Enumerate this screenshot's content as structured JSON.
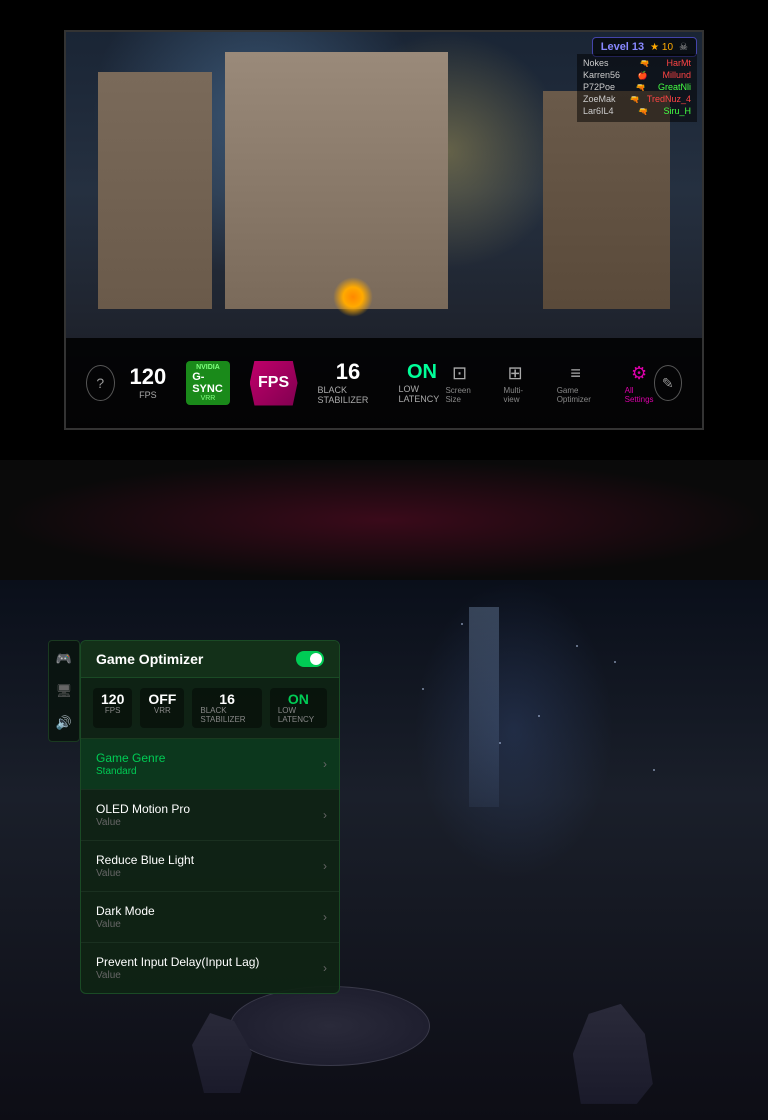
{
  "top_section": {
    "level": {
      "label": "Level 13",
      "stars": "★ 10",
      "skull": "☠"
    },
    "scoreboard": {
      "players": [
        {
          "name": "Nokes",
          "icon": "🔫",
          "team": "HarMt",
          "color": "red"
        },
        {
          "name": "Karren56",
          "icon": "🍎",
          "team": "Millund",
          "color": "red"
        },
        {
          "name": "P72Poe",
          "icon": "🔫",
          "team": "GreatNli",
          "color": "green"
        },
        {
          "name": "ZoeMak",
          "icon": "🔫",
          "team": "TredNuz_4",
          "color": "red"
        },
        {
          "name": "Lar6IL4",
          "icon": "🔫",
          "team": "Siru_H",
          "color": "green"
        }
      ]
    },
    "hud": {
      "fps_value": "120",
      "fps_label": "FPS",
      "gsync_label": "NVIDIA",
      "gsync_name": "G-SYNC",
      "gsync_vrr": "VRR",
      "center_badge": "FPS",
      "black_stab_value": "16",
      "black_stab_label": "Black Stabilizer",
      "latency_value": "ON",
      "latency_label": "Low Latency"
    },
    "bottom_icons": {
      "help_icon": "?",
      "screen_size_label": "Screen Size",
      "screen_size_icon": "⊡",
      "multiview_label": "Multi-view",
      "multiview_icon": "⊞",
      "optimizer_label": "Game Optimizer",
      "optimizer_icon": "≡",
      "settings_label": "All Settings",
      "settings_icon": "⚙",
      "edit_icon": "✎"
    }
  },
  "bottom_section": {
    "side_icons": {
      "gamepad_icon": "🎮",
      "display_icon": "🖥",
      "volume_icon": "🔊"
    },
    "optimizer_panel": {
      "title": "Game Optimizer",
      "toggle_on": true,
      "stats": [
        {
          "value": "120",
          "label": "FPS"
        },
        {
          "value": "OFF",
          "label": "VRR"
        },
        {
          "value": "16",
          "label": "Black Stabilizer"
        },
        {
          "value": "ON",
          "label": "Low Latency"
        }
      ],
      "menu_items": [
        {
          "title": "Game Genre",
          "value": "Standard",
          "highlighted": true,
          "title_color": "green",
          "value_color": "green"
        },
        {
          "title": "OLED Motion Pro",
          "value": "Value",
          "highlighted": false
        },
        {
          "title": "Reduce Blue Light",
          "value": "Value",
          "highlighted": false
        },
        {
          "title": "Dark Mode",
          "value": "Value",
          "highlighted": false
        },
        {
          "title": "Prevent Input Delay(Input Lag)",
          "value": "Value",
          "highlighted": false
        }
      ]
    }
  }
}
